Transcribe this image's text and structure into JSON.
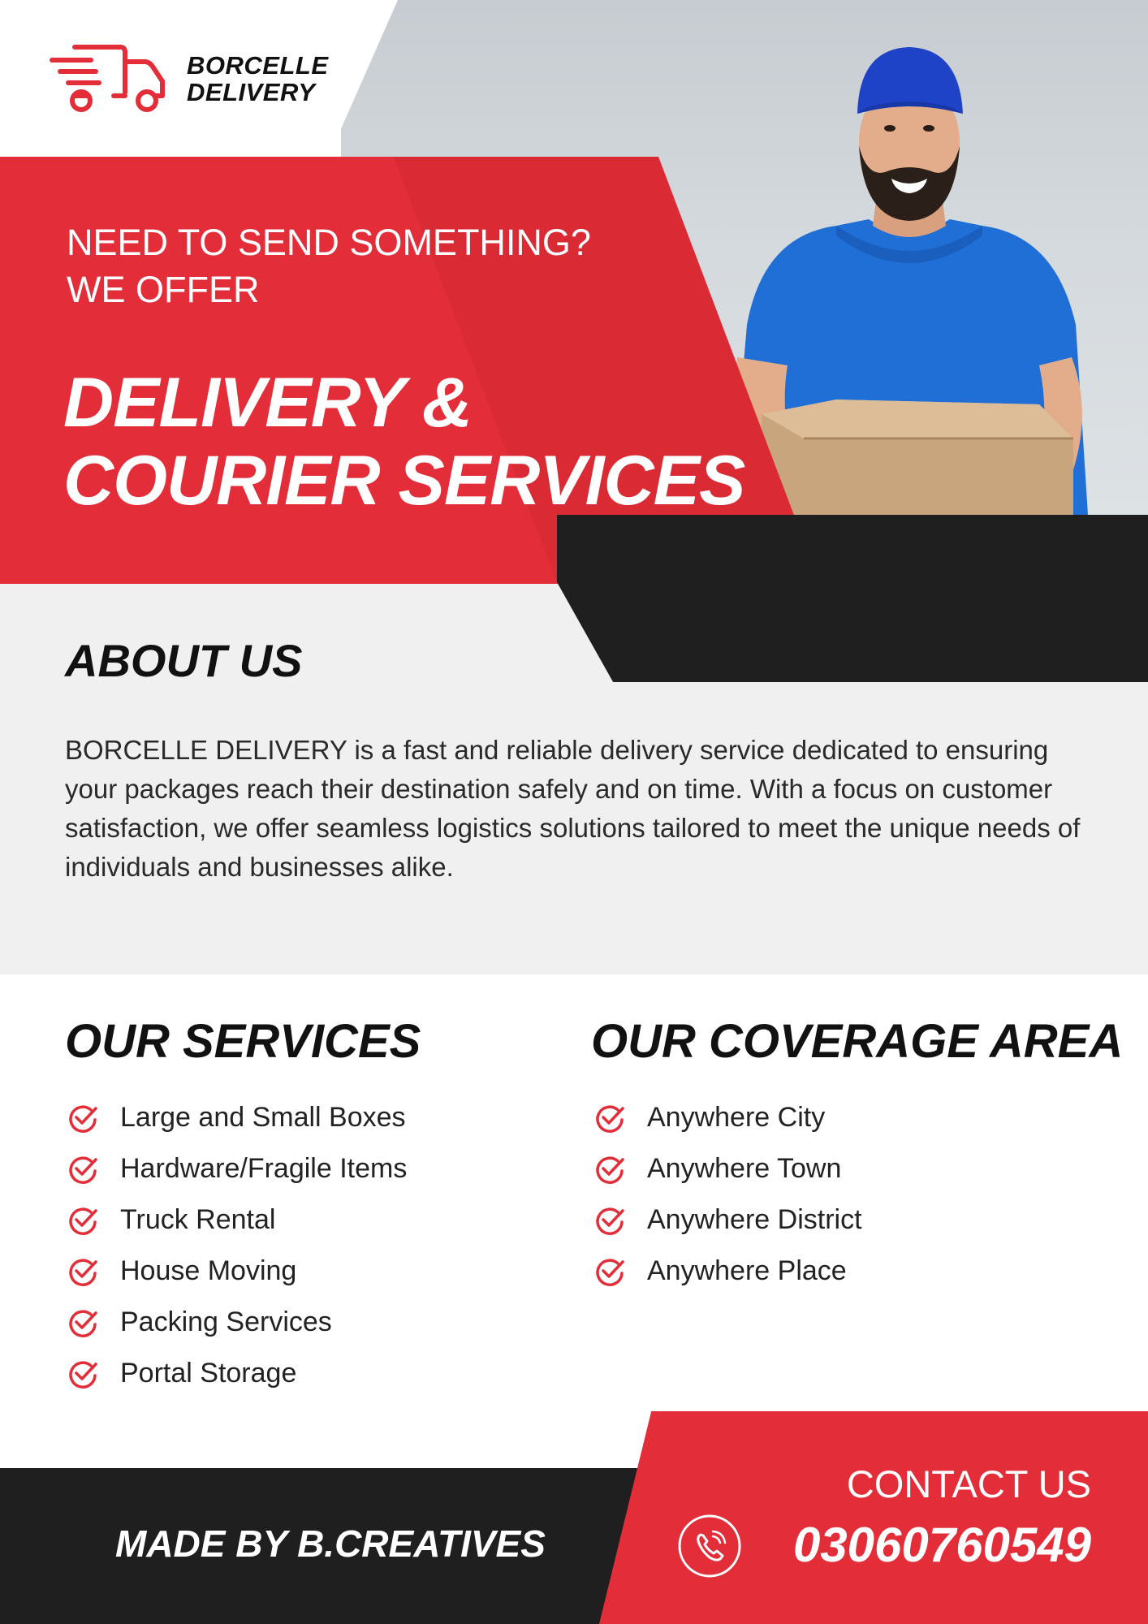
{
  "brand": {
    "line1": "BORCELLE",
    "line2": "DELIVERY",
    "logo_icon": "delivery-truck-icon"
  },
  "hero": {
    "tagline_line1": "NEED TO SEND SOMETHING?",
    "tagline_line2": "WE OFFER",
    "headline_line1": "DELIVERY &",
    "headline_line2": "COURIER SERVICES"
  },
  "about": {
    "title": "ABOUT US",
    "body": "BORCELLE DELIVERY is a fast and reliable delivery service dedicated to ensuring your packages reach their destination safely and on time. With a focus on customer satisfaction, we offer seamless logistics solutions tailored to meet the unique needs of individuals and businesses alike."
  },
  "services": {
    "title": "OUR SERVICES",
    "items": [
      "Large and Small Boxes",
      "Hardware/Fragile Items",
      "Truck Rental",
      "House Moving",
      "Packing Services",
      "Portal Storage"
    ]
  },
  "coverage": {
    "title": "OUR COVERAGE AREA",
    "items": [
      "Anywhere City",
      "Anywhere Town",
      "Anywhere District",
      "Anywhere Place"
    ]
  },
  "footer": {
    "made_by": "MADE BY B.CREATIVES",
    "contact_label": "CONTACT US",
    "phone": "03060760549",
    "phone_icon": "phone-icon"
  },
  "colors": {
    "accent_red": "#e32d38",
    "dark": "#1f1f1f",
    "light_gray": "#f0f0f0"
  }
}
